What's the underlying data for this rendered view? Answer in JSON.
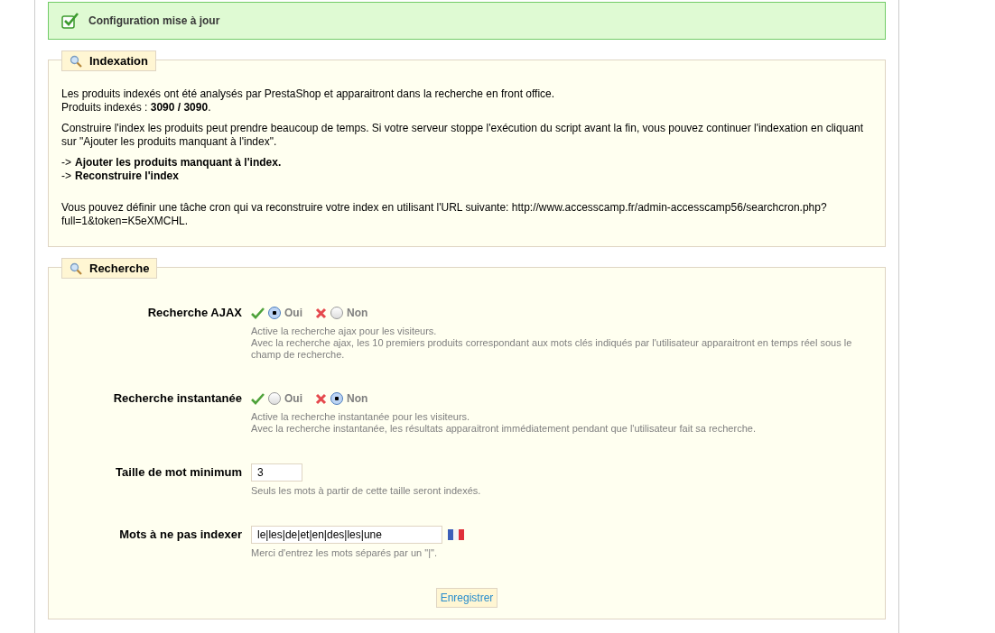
{
  "notice": {
    "text": "Configuration mise à jour"
  },
  "indexation": {
    "legend": "Indexation",
    "intro": [
      "Les produits indexés ont été analysés par PrestaShop et apparaitront dans la recherche en front office.",
      "Produits indexés : **3090 / 3090**."
    ],
    "explanation": "Construire l'index les produits peut prendre beaucoup de temps. Si votre serveur stoppe l'exécution du script avant la fin, vous pouvez continuer l'indexation en cliquant sur \"Ajouter les produits manquant à l'index\".",
    "links": [
      {
        "prefix": "->",
        "label": "Ajouter les produits manquant à l'index."
      },
      {
        "prefix": "->",
        "label": "Reconstruire l'index"
      }
    ],
    "cron": "Vous pouvez définir une tâche cron qui va reconstruire votre index en utilisant l'URL suivante: http://www.accesscamp.fr/admin-accesscamp56/searchcron.php?full=1&token=K5eXMCHL."
  },
  "recherche": {
    "legend": "Recherche",
    "fields": [
      {
        "kind": "toggle",
        "label": "Recherche AJAX",
        "options": [
          {
            "label": "Oui",
            "selected": true
          },
          {
            "label": "Non",
            "selected": false
          }
        ],
        "help": [
          "Active la recherche ajax pour les visiteurs.",
          "Avec la recherche ajax, les 10 premiers produits correspondant aux mots clés indiqués par l'utilisateur apparaitront en temps réel sous le champ de recherche."
        ]
      },
      {
        "kind": "toggle",
        "label": "Recherche instantanée",
        "options": [
          {
            "label": "Oui",
            "selected": false
          },
          {
            "label": "Non",
            "selected": true
          }
        ],
        "help": [
          "Active la recherche instantanée pour les visiteurs.",
          "Avec la recherche instantanée, les résultats apparaitront immédiatement pendant que l'utilisateur fait sa recherche."
        ]
      },
      {
        "kind": "short",
        "label": "Taille de mot minimum",
        "value": "3",
        "help": [
          "Seuls les mots à partir de cette taille seront indexés."
        ]
      },
      {
        "kind": "long",
        "label": "Mots à ne pas indexer",
        "value": "le|les|de|et|en|des|les|une",
        "help": [
          "Merci d'entrez les mots séparés par un \"|\"."
        ]
      }
    ],
    "submit": "Enregistrer"
  }
}
